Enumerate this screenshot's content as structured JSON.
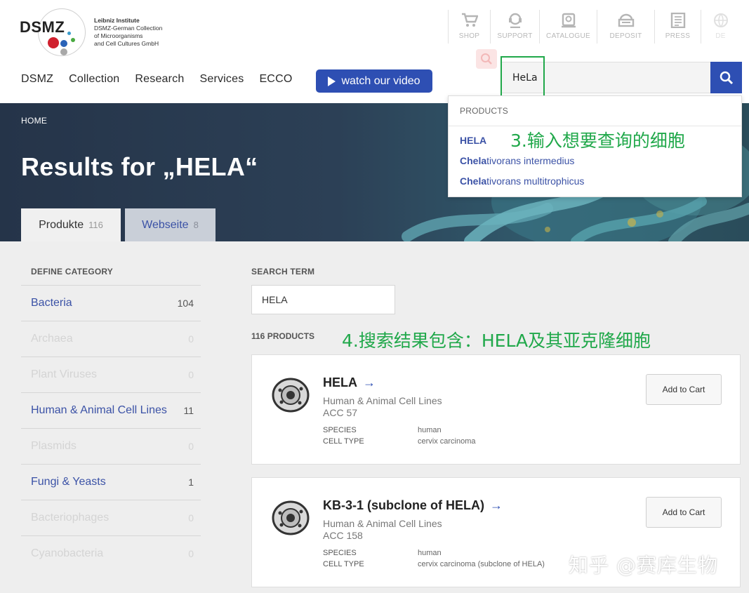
{
  "logo": {
    "wordmark": "DSMZ",
    "line1": "Leibniz Institute",
    "line2": "DSMZ-German Collection",
    "line3": "of Microorganisms",
    "line4": "and Cell Cultures GmbH"
  },
  "top_links": [
    {
      "label": "SHOP",
      "icon": "cart-icon"
    },
    {
      "label": "SUPPORT",
      "icon": "support-icon"
    },
    {
      "label": "CATALOGUE",
      "icon": "catalogue-icon"
    },
    {
      "label": "DEPOSIT",
      "icon": "deposit-icon"
    },
    {
      "label": "PRESS",
      "icon": "press-icon"
    },
    {
      "label": "DE",
      "icon": "globe-icon"
    }
  ],
  "nav": [
    "DSMZ",
    "Collection",
    "Research",
    "Services",
    "ECCO"
  ],
  "video_button": "watch our video",
  "search": {
    "value": "HeLa"
  },
  "suggest": {
    "header": "PRODUCTS",
    "items": [
      {
        "bold": "HELA",
        "rest": ""
      },
      {
        "bold": "Chela",
        "rest": "tivorans intermedius"
      },
      {
        "bold": "Chela",
        "rest": "tivorans multitrophicus"
      }
    ]
  },
  "annotations": {
    "step3": "3.输入想要查询的细胞",
    "step4": "4.搜索结果包含：HELA及其亚克隆细胞"
  },
  "hero": {
    "breadcrumb": "HOME",
    "title": "Results for „HELA“",
    "tabs": [
      {
        "label": "Produkte",
        "count": "116"
      },
      {
        "label": "Webseite",
        "count": "8"
      }
    ]
  },
  "sidebar": {
    "heading": "DEFINE CATEGORY",
    "categories": [
      {
        "name": "Bacteria",
        "count": "104"
      },
      {
        "name": "Archaea",
        "count": "0"
      },
      {
        "name": "Plant Viruses",
        "count": "0"
      },
      {
        "name": "Human & Animal Cell Lines",
        "count": "11"
      },
      {
        "name": "Plasmids",
        "count": "0"
      },
      {
        "name": "Fungi & Yeasts",
        "count": "1"
      },
      {
        "name": "Bacteriophages",
        "count": "0"
      },
      {
        "name": "Cyanobacteria",
        "count": "0"
      }
    ]
  },
  "search_term": {
    "heading": "SEARCH TERM",
    "value": "HELA"
  },
  "products_count": "116 PRODUCTS",
  "products": [
    {
      "title": "HELA",
      "category": "Human & Animal Cell Lines",
      "acc": "ACC 57",
      "species_label": "SPECIES",
      "species": "human",
      "celltype_label": "CELL TYPE",
      "celltype": "cervix carcinoma",
      "cart": "Add to Cart"
    },
    {
      "title": "KB-3-1 (subclone of HELA)",
      "category": "Human & Animal Cell Lines",
      "acc": "ACC 158",
      "species_label": "SPECIES",
      "species": "human",
      "celltype_label": "CELL TYPE",
      "celltype": "cervix carcinoma (subclone of HELA)",
      "cart": "Add to Cart"
    }
  ],
  "watermark": "知乎 @赛库生物"
}
